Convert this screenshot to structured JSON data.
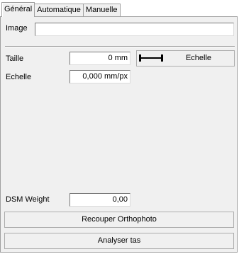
{
  "tabs": [
    {
      "label": "Général"
    },
    {
      "label": "Automatique"
    },
    {
      "label": "Manuelle"
    }
  ],
  "image": {
    "label": "Image",
    "value": ""
  },
  "taille": {
    "label": "Taille",
    "value": "0 mm"
  },
  "echelle": {
    "label": "Echelle",
    "value": "0,000 mm/px"
  },
  "echelle_button": {
    "label": "Echelle",
    "icon": "ruler-icon"
  },
  "dsm_weight": {
    "label": "DSM Weight",
    "value": "0,00"
  },
  "buttons": {
    "recouper": "Recouper Orthophoto",
    "analyser": "Analyser tas"
  }
}
